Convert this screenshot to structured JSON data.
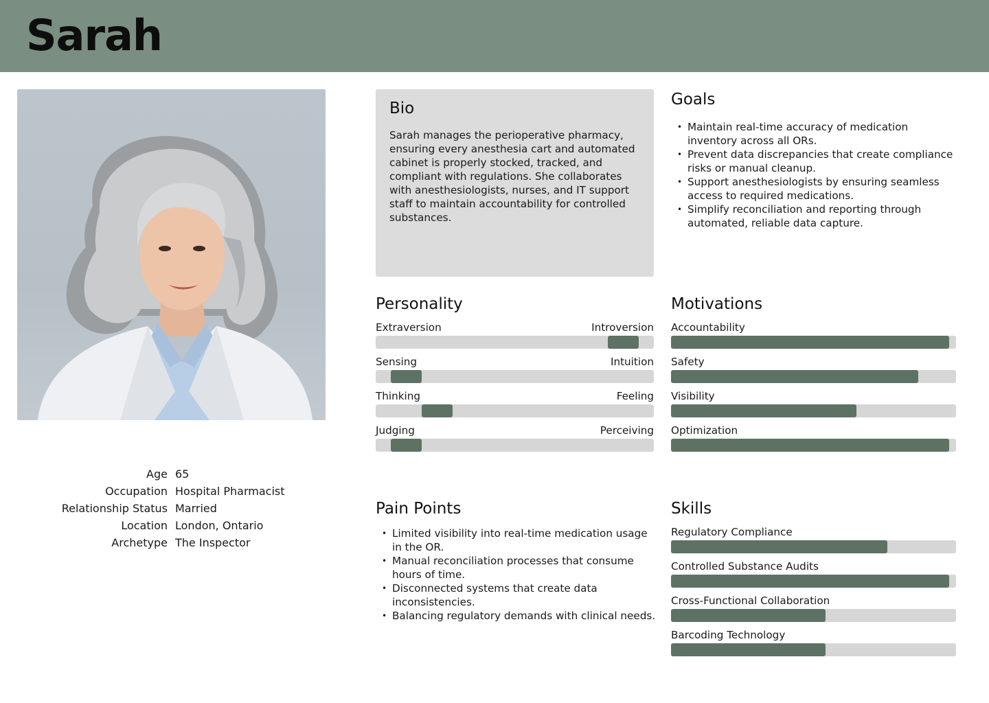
{
  "persona": {
    "name": "Sarah"
  },
  "demographics": [
    {
      "label": "Age",
      "value": "65"
    },
    {
      "label": "Occupation",
      "value": "Hospital Pharmacist"
    },
    {
      "label": "Relationship Status",
      "value": "Married"
    },
    {
      "label": "Location",
      "value": "London, Ontario"
    },
    {
      "label": "Archetype",
      "value": "The Inspector"
    }
  ],
  "bio": {
    "title": "Bio",
    "text": "Sarah manages the perioperative pharmacy, ensuring every anesthesia cart and automated cabinet is properly stocked, tracked, and compliant with regulations. She collaborates with anesthesiologists, nurses, and IT support staff to maintain accountability for controlled substances."
  },
  "goals": {
    "title": "Goals",
    "items": [
      "Maintain real-time accuracy of medication inventory across all ORs.",
      "Prevent data discrepancies that create compliance risks or manual cleanup.",
      "Support anesthesiologists by ensuring seamless access to required medications.",
      "Simplify reconciliation and reporting through automated, reliable data capture."
    ]
  },
  "personality": {
    "title": "Personality",
    "traits": [
      {
        "left": "Extraversion",
        "right": "Introversion",
        "position": 0.89
      },
      {
        "left": "Sensing",
        "right": "Intuition",
        "position": 0.11
      },
      {
        "left": "Thinking",
        "right": "Feeling",
        "position": 0.22
      },
      {
        "left": "Judging",
        "right": "Perceiving",
        "position": 0.11
      }
    ]
  },
  "motivations": {
    "title": "Motivations",
    "items": [
      {
        "label": "Accountability",
        "level": 0.976
      },
      {
        "label": "Safety",
        "level": 0.867
      },
      {
        "label": "Visibility",
        "level": 0.651
      },
      {
        "label": "Optimization",
        "level": 0.976
      }
    ]
  },
  "pain_points": {
    "title": "Pain Points",
    "items": [
      "Limited visibility into real-time medication usage in the OR.",
      "Manual reconciliation processes that consume hours of time.",
      "Disconnected systems that create data inconsistencies.",
      "Balancing regulatory demands with clinical needs."
    ]
  },
  "skills": {
    "title": "Skills",
    "items": [
      {
        "label": "Regulatory Compliance",
        "level": 0.759
      },
      {
        "label": "Controlled Substance Audits",
        "level": 0.976
      },
      {
        "label": "Cross-Functional Collaboration",
        "level": 0.542
      },
      {
        "label": "Barcoding Technology",
        "level": 0.542
      }
    ]
  },
  "colors": {
    "header": "#7a8e82",
    "bar_fill": "#5d7264",
    "bar_track": "#d6d6d6",
    "bio_background": "#dcdcdc"
  }
}
